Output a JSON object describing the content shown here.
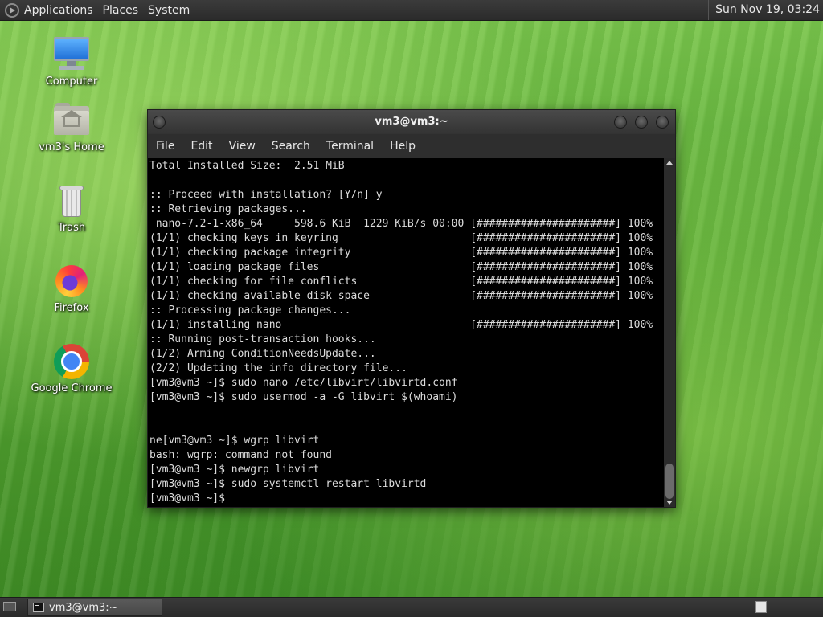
{
  "top_panel": {
    "menus": [
      "Applications",
      "Places",
      "System"
    ],
    "clock": "Sun Nov 19, 03:24"
  },
  "desktop_icons": [
    {
      "label": "Computer",
      "icon": "computer-icon"
    },
    {
      "label": "vm3's Home",
      "icon": "home-folder-icon"
    },
    {
      "label": "Trash",
      "icon": "trash-icon"
    },
    {
      "label": "Firefox",
      "icon": "firefox-icon"
    },
    {
      "label": "Google Chrome",
      "icon": "chrome-icon"
    }
  ],
  "terminal": {
    "title": "vm3@vm3:~",
    "menu": [
      "File",
      "Edit",
      "View",
      "Search",
      "Terminal",
      "Help"
    ],
    "lines": [
      "Total Installed Size:  2.51 MiB",
      "",
      ":: Proceed with installation? [Y/n] y",
      ":: Retrieving packages...",
      " nano-7.2-1-x86_64     598.6 KiB  1229 KiB/s 00:00 [######################] 100%",
      "(1/1) checking keys in keyring                     [######################] 100%",
      "(1/1) checking package integrity                   [######################] 100%",
      "(1/1) loading package files                        [######################] 100%",
      "(1/1) checking for file conflicts                  [######################] 100%",
      "(1/1) checking available disk space                [######################] 100%",
      ":: Processing package changes...",
      "(1/1) installing nano                              [######################] 100%",
      ":: Running post-transaction hooks...",
      "(1/2) Arming ConditionNeedsUpdate...",
      "(2/2) Updating the info directory file...",
      "[vm3@vm3 ~]$ sudo nano /etc/libvirt/libvirtd.conf",
      "[vm3@vm3 ~]$ sudo usermod -a -G libvirt $(whoami)",
      "",
      "",
      "ne[vm3@vm3 ~]$ wgrp libvirt",
      "bash: wgrp: command not found",
      "[vm3@vm3 ~]$ newgrp libvirt",
      "[vm3@vm3 ~]$ sudo systemctl restart libvirtd",
      "[vm3@vm3 ~]$ "
    ]
  },
  "taskbar": {
    "task_label": "vm3@vm3:~"
  }
}
